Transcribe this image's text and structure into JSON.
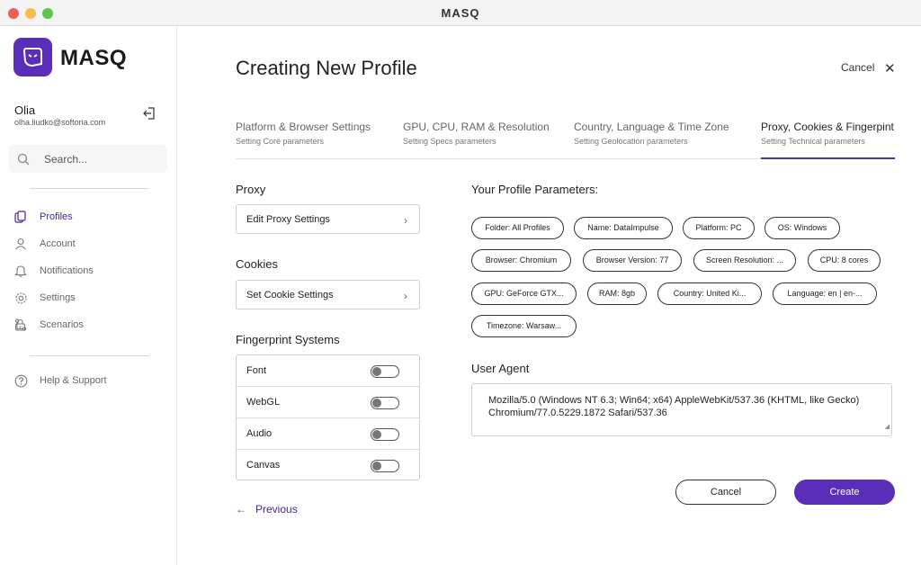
{
  "window": {
    "title": "MASQ"
  },
  "sidebar": {
    "logo_text": "MASQ",
    "user": {
      "name": "Olia",
      "email": "olha.liudko@softoria.com"
    },
    "search": {
      "placeholder": "Search..."
    },
    "items": [
      {
        "label": "Profiles",
        "active": true
      },
      {
        "label": "Account"
      },
      {
        "label": "Notifications"
      },
      {
        "label": "Settings"
      },
      {
        "label": "Scenarios",
        "locked": true
      }
    ],
    "help": {
      "label": "Help & Support"
    }
  },
  "main": {
    "title": "Creating New Profile",
    "cancel_label": "Cancel",
    "steps": [
      {
        "title": "Platform & Browser Settings",
        "subtitle": "Setting Core parameters"
      },
      {
        "title": "GPU, CPU, RAM & Resolution",
        "subtitle": "Setting Specs parameters"
      },
      {
        "title": "Country, Language & Time Zone",
        "subtitle": "Setting Geolocation parameters"
      },
      {
        "title": "Proxy, Cookies & Fingerpint",
        "subtitle": "Setting Technical parameters",
        "active": true
      }
    ],
    "proxy": {
      "heading": "Proxy",
      "button": "Edit Proxy Settings"
    },
    "cookies": {
      "heading": "Cookies",
      "button": "Set Cookie Settings"
    },
    "fingerprint": {
      "heading": "Fingerprint Systems",
      "items": [
        {
          "label": "Font",
          "enabled": false
        },
        {
          "label": "WebGL",
          "enabled": false
        },
        {
          "label": "Audio",
          "enabled": false
        },
        {
          "label": "Canvas",
          "enabled": false
        }
      ]
    },
    "previous_label": "Previous",
    "params": {
      "heading": "Your Profile Parameters:",
      "chips": [
        "Folder: All Profiles",
        "Name: DataImpulse",
        "Platform: PC",
        "OS: Windows",
        "Browser: Chromium",
        "Browser Version: 77",
        "Screen Resolution: ...",
        "CPU: 8 cores",
        "GPU: GeForce GTX...",
        "RAM: 8gb",
        "Country: United Ki...",
        "Language: en | en-...",
        "Timezone: Warsaw..."
      ]
    },
    "user_agent": {
      "heading": "User Agent",
      "value": "Mozilla/5.0 (Windows NT 6.3; Win64; x64) AppleWebKit/537.36 (KHTML, like Gecko) Chromium/77.0.5229.1872 Safari/537.36"
    },
    "buttons": {
      "cancel": "Cancel",
      "create": "Create"
    }
  },
  "colors": {
    "accent": "#5a2eb8",
    "active_nav": "#4b2399"
  }
}
